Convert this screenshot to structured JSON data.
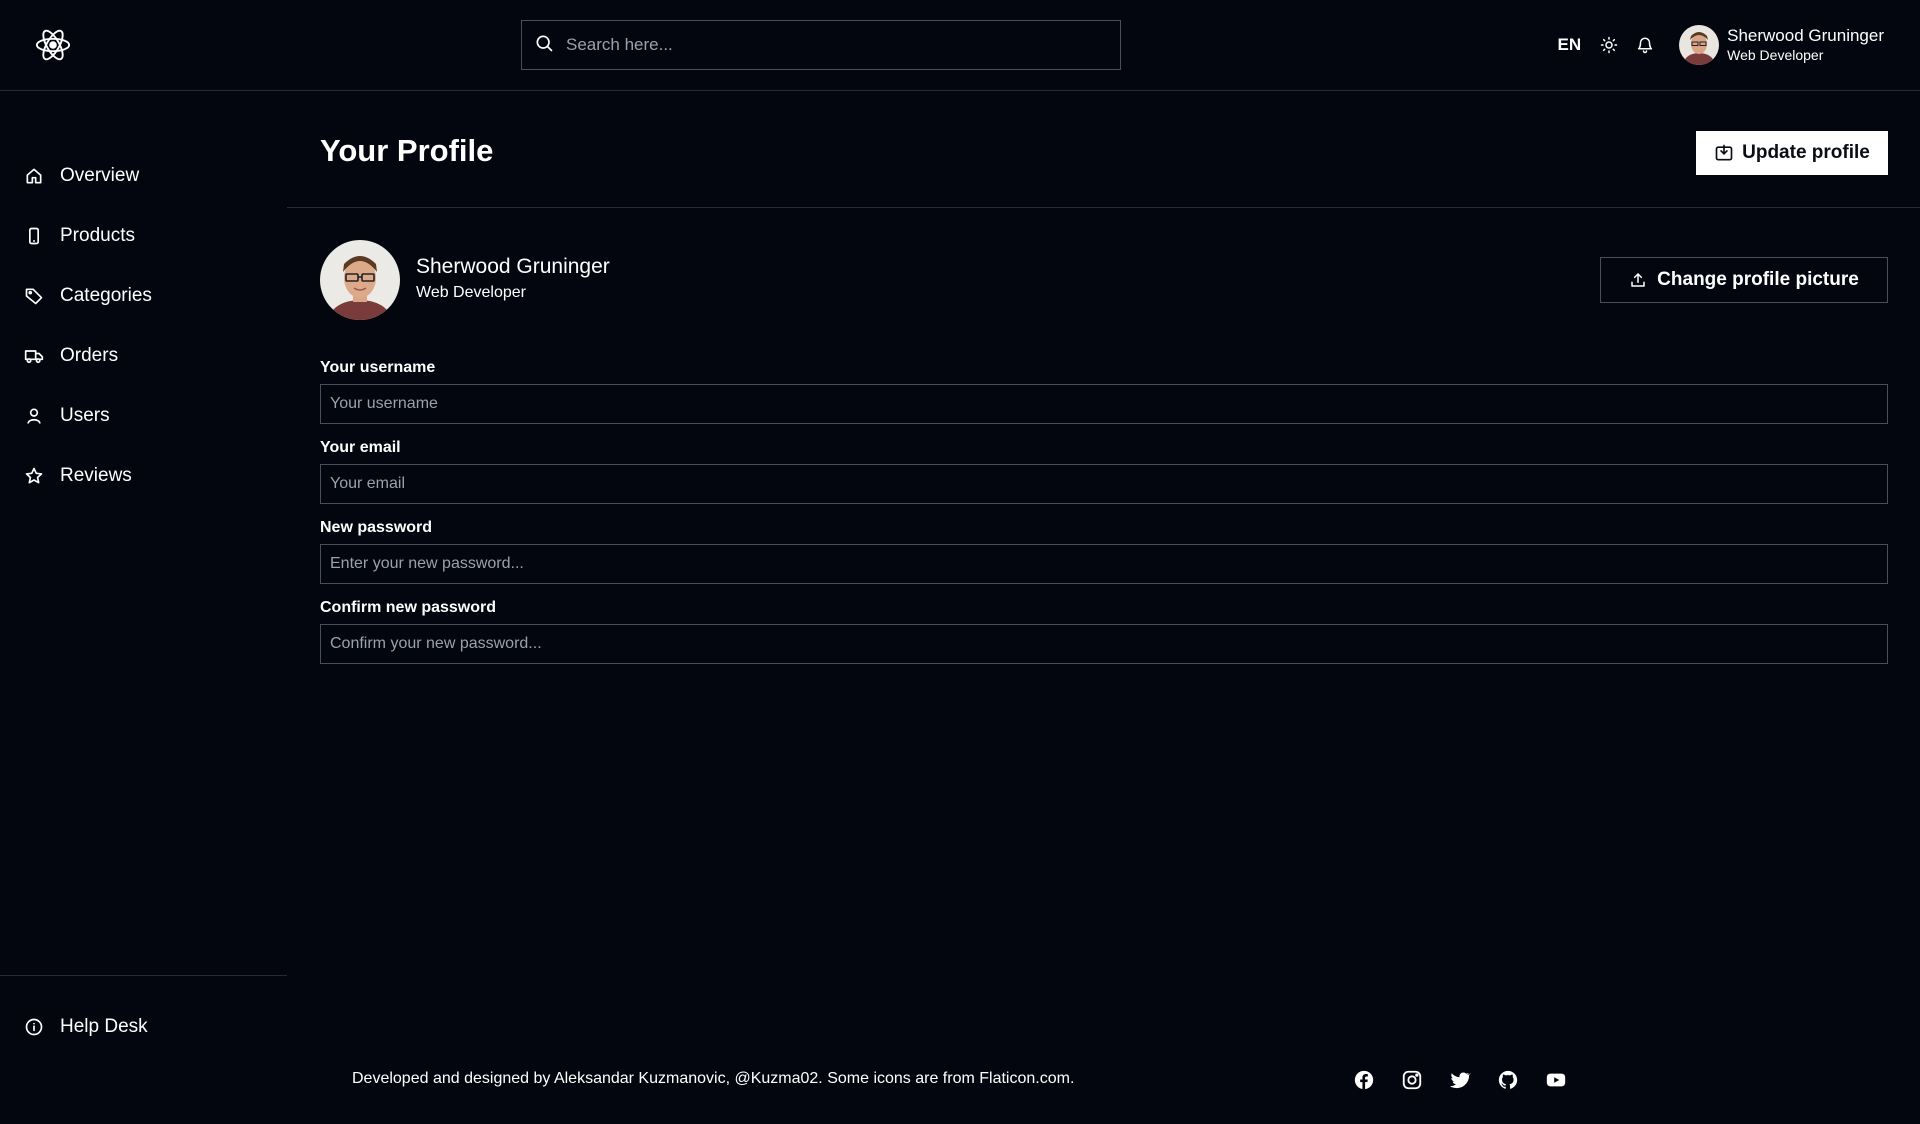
{
  "header": {
    "search_placeholder": "Search here...",
    "language": "EN",
    "user": {
      "name": "Sherwood Gruninger",
      "role": "Web Developer"
    }
  },
  "sidebar": {
    "items": [
      {
        "label": "Overview",
        "icon": "home-icon"
      },
      {
        "label": "Products",
        "icon": "smartphone-icon"
      },
      {
        "label": "Categories",
        "icon": "tag-icon"
      },
      {
        "label": "Orders",
        "icon": "truck-icon"
      },
      {
        "label": "Users",
        "icon": "user-icon"
      },
      {
        "label": "Reviews",
        "icon": "star-icon"
      }
    ],
    "help": {
      "label": "Help Desk",
      "icon": "info-icon"
    }
  },
  "main": {
    "title": "Your Profile",
    "update_button": "Update profile",
    "profile": {
      "name": "Sherwood Gruninger",
      "role": "Web Developer"
    },
    "change_picture_button": "Change profile picture",
    "fields": [
      {
        "label": "Your username",
        "placeholder": "Your username"
      },
      {
        "label": "Your email",
        "placeholder": "Your email"
      },
      {
        "label": "New password",
        "placeholder": "Enter your new password..."
      },
      {
        "label": "Confirm new password",
        "placeholder": "Confirm your new password..."
      }
    ]
  },
  "footer": {
    "text": "Developed and designed by Aleksandar Kuzmanovic, @Kuzma02. Some icons are from Flaticon.com.",
    "socials": [
      "facebook-icon",
      "instagram-icon",
      "twitter-icon",
      "github-icon",
      "youtube-icon"
    ]
  },
  "colors": {
    "background": "#03060e",
    "border": "#4a4e57",
    "text": "#ffffff",
    "button_bg": "#ffffff"
  }
}
